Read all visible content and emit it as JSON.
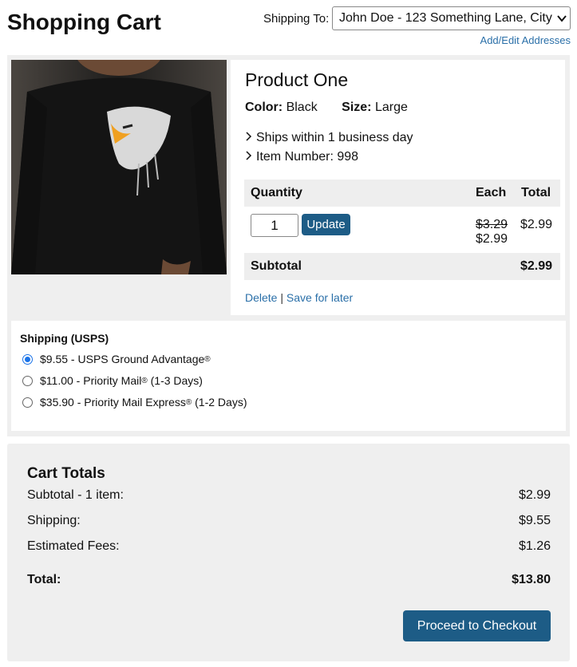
{
  "header": {
    "title": "Shopping Cart",
    "shipping_to_label": "Shipping To:",
    "address_value": "John Doe - 123 Something Lane, City",
    "edit_addresses": "Add/Edit Addresses"
  },
  "product": {
    "name": "Product One",
    "color_label": "Color:",
    "color_value": "Black",
    "size_label": "Size:",
    "size_value": "Large",
    "ships_text": "Ships within 1 business day",
    "item_number_text": "Item Number: 998",
    "table": {
      "quantity_header": "Quantity",
      "each_header": "Each",
      "total_header": "Total",
      "quantity": "1",
      "update_label": "Update",
      "old_price": "$3.29",
      "new_price": "$2.99",
      "row_total": "$2.99",
      "subtotal_label": "Subtotal",
      "subtotal_value": "$2.99"
    },
    "delete_label": "Delete",
    "separator": "|",
    "save_label": "Save for later"
  },
  "shipping": {
    "title": "Shipping (USPS)",
    "options": [
      {
        "price": "$9.55",
        "name": "USPS Ground Advantage",
        "reg": "®",
        "suffix": "",
        "selected": true
      },
      {
        "price": "$11.00",
        "name": "Priority Mail",
        "reg": "®",
        "suffix": " (1-3 Days)",
        "selected": false
      },
      {
        "price": "$35.90",
        "name": "Priority Mail Express",
        "reg": "®",
        "suffix": " (1-2 Days)",
        "selected": false
      }
    ]
  },
  "totals": {
    "title": "Cart Totals",
    "subtotal_label": "Subtotal - 1 item:",
    "subtotal_value": "$2.99",
    "shipping_label": "Shipping:",
    "shipping_value": "$9.55",
    "fees_label": "Estimated Fees:",
    "fees_value": "$1.26",
    "total_label": "Total:",
    "total_value": "$13.80",
    "checkout_label": "Proceed to Checkout"
  },
  "colors": {
    "accent": "#1d5c86",
    "link": "#2a6fa8",
    "panel": "#efefef"
  },
  "icons": [
    "chevron-down-icon",
    "chevron-right-icon",
    "product-photo"
  ]
}
